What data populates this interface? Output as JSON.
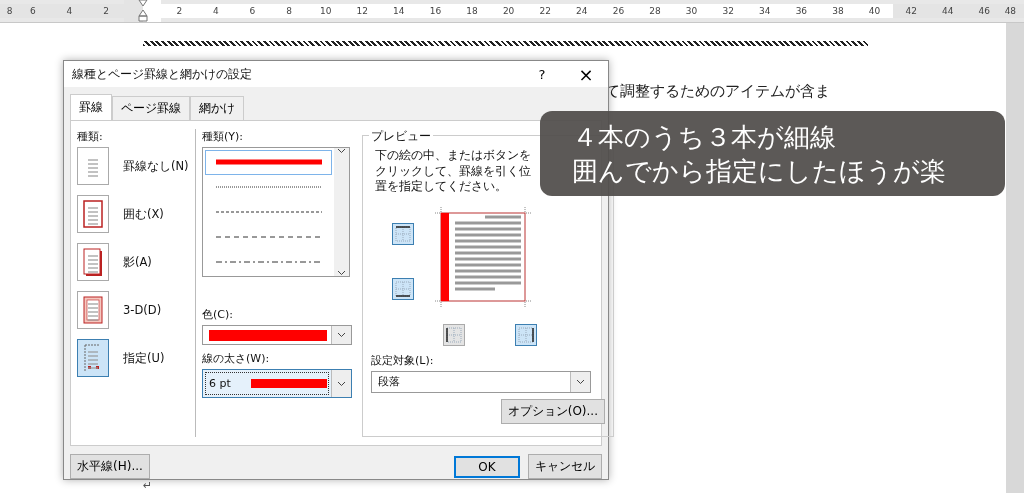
{
  "ruler": {
    "labels": [
      "8",
      "6",
      "4",
      "2",
      "2",
      "4",
      "6",
      "8",
      "10",
      "12",
      "14",
      "16",
      "18",
      "20",
      "22",
      "24",
      "26",
      "28",
      "30",
      "32",
      "34",
      "36",
      "38",
      "40",
      "42",
      "44",
      "46",
      "48"
    ]
  },
  "document": {
    "lines": [
      "て調整するためのアイテムが含ま"
    ],
    "paragraph_mark": "↵"
  },
  "dialog": {
    "title": "線種とページ罫線と網かけの設定",
    "help": "?",
    "close": "×",
    "tabs": [
      {
        "label": "罫線",
        "selected": true
      },
      {
        "label": "ページ罫線",
        "selected": false
      },
      {
        "label": "網かけ",
        "selected": false
      }
    ],
    "setting": {
      "label": "種類:",
      "items": [
        {
          "kind": "none",
          "label": "罫線なし(N)",
          "selected": false
        },
        {
          "kind": "box",
          "label": "囲む(X)",
          "selected": false
        },
        {
          "kind": "shadow",
          "label": "影(A)",
          "selected": false
        },
        {
          "kind": "threed",
          "label": "3-D(D)",
          "selected": false
        },
        {
          "kind": "custom",
          "label": "指定(U)",
          "selected": true
        }
      ]
    },
    "style": {
      "label": "種類(Y):",
      "items": [
        {
          "kind": "solid",
          "selected": true
        },
        {
          "kind": "dotted",
          "selected": false
        },
        {
          "kind": "dashed",
          "selected": false
        },
        {
          "kind": "longdash",
          "selected": false
        },
        {
          "kind": "dashdot",
          "selected": false
        }
      ]
    },
    "color": {
      "label": "色(C):"
    },
    "width": {
      "label": "線の太さ(W):",
      "value": "6 pt"
    },
    "preview": {
      "title": "プレビュー",
      "hint": "下の絵の中、またはボタンをクリックして、罫線を引く位置を指定してください。",
      "buttons": [
        {
          "kind": "top",
          "on": true
        },
        {
          "kind": "bottom",
          "on": true
        },
        {
          "kind": "left",
          "on": false
        },
        {
          "kind": "right",
          "on": true
        }
      ]
    },
    "apply_to": {
      "label": "設定対象(L):",
      "value": "段落"
    },
    "options_button": "オプション(O)...",
    "horizontal_line_button": "水平線(H)...",
    "ok": "OK",
    "cancel": "キャンセル"
  },
  "caption": [
    "４本のうち３本が細線",
    "囲んでから指定にしたほうが楽"
  ]
}
